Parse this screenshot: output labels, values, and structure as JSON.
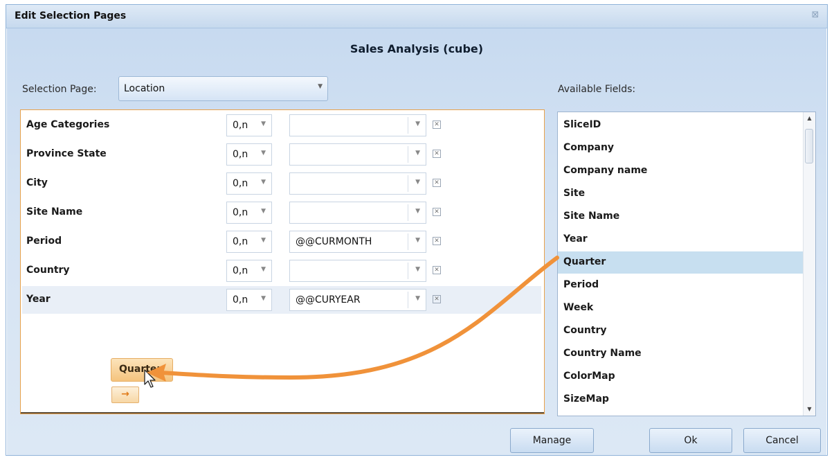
{
  "window": {
    "title": "Edit Selection Pages",
    "close_icon": "close-icon"
  },
  "heading": "Sales Analysis (cube)",
  "selection_page": {
    "label": "Selection Page:",
    "value": "Location"
  },
  "available_fields_label": "Available Fields:",
  "rows": [
    {
      "label": "Age Categories",
      "cardinality": "0,n",
      "value": ""
    },
    {
      "label": "Province State",
      "cardinality": "0,n",
      "value": ""
    },
    {
      "label": "City",
      "cardinality": "0,n",
      "value": ""
    },
    {
      "label": "Site Name",
      "cardinality": "0,n",
      "value": ""
    },
    {
      "label": "Period",
      "cardinality": "0,n",
      "value": "@@CURMONTH"
    },
    {
      "label": "Country",
      "cardinality": "0,n",
      "value": ""
    },
    {
      "label": "Year",
      "cardinality": "0,n",
      "value": "@@CURYEAR"
    }
  ],
  "drag": {
    "chip_label": "Quarter",
    "drop_button_icon": "→"
  },
  "fields": [
    "SliceID",
    "Company",
    "Company name",
    "Site",
    "Site Name",
    "Year",
    "Quarter",
    "Period",
    "Week",
    "Country",
    "Country Name",
    "ColorMap",
    "SizeMap"
  ],
  "selected_field": "Quarter",
  "buttons": {
    "manage": "Manage",
    "ok": "Ok",
    "cancel": "Cancel"
  },
  "colors": {
    "accent_orange": "#f0923a",
    "selection": "#c7dff0"
  }
}
